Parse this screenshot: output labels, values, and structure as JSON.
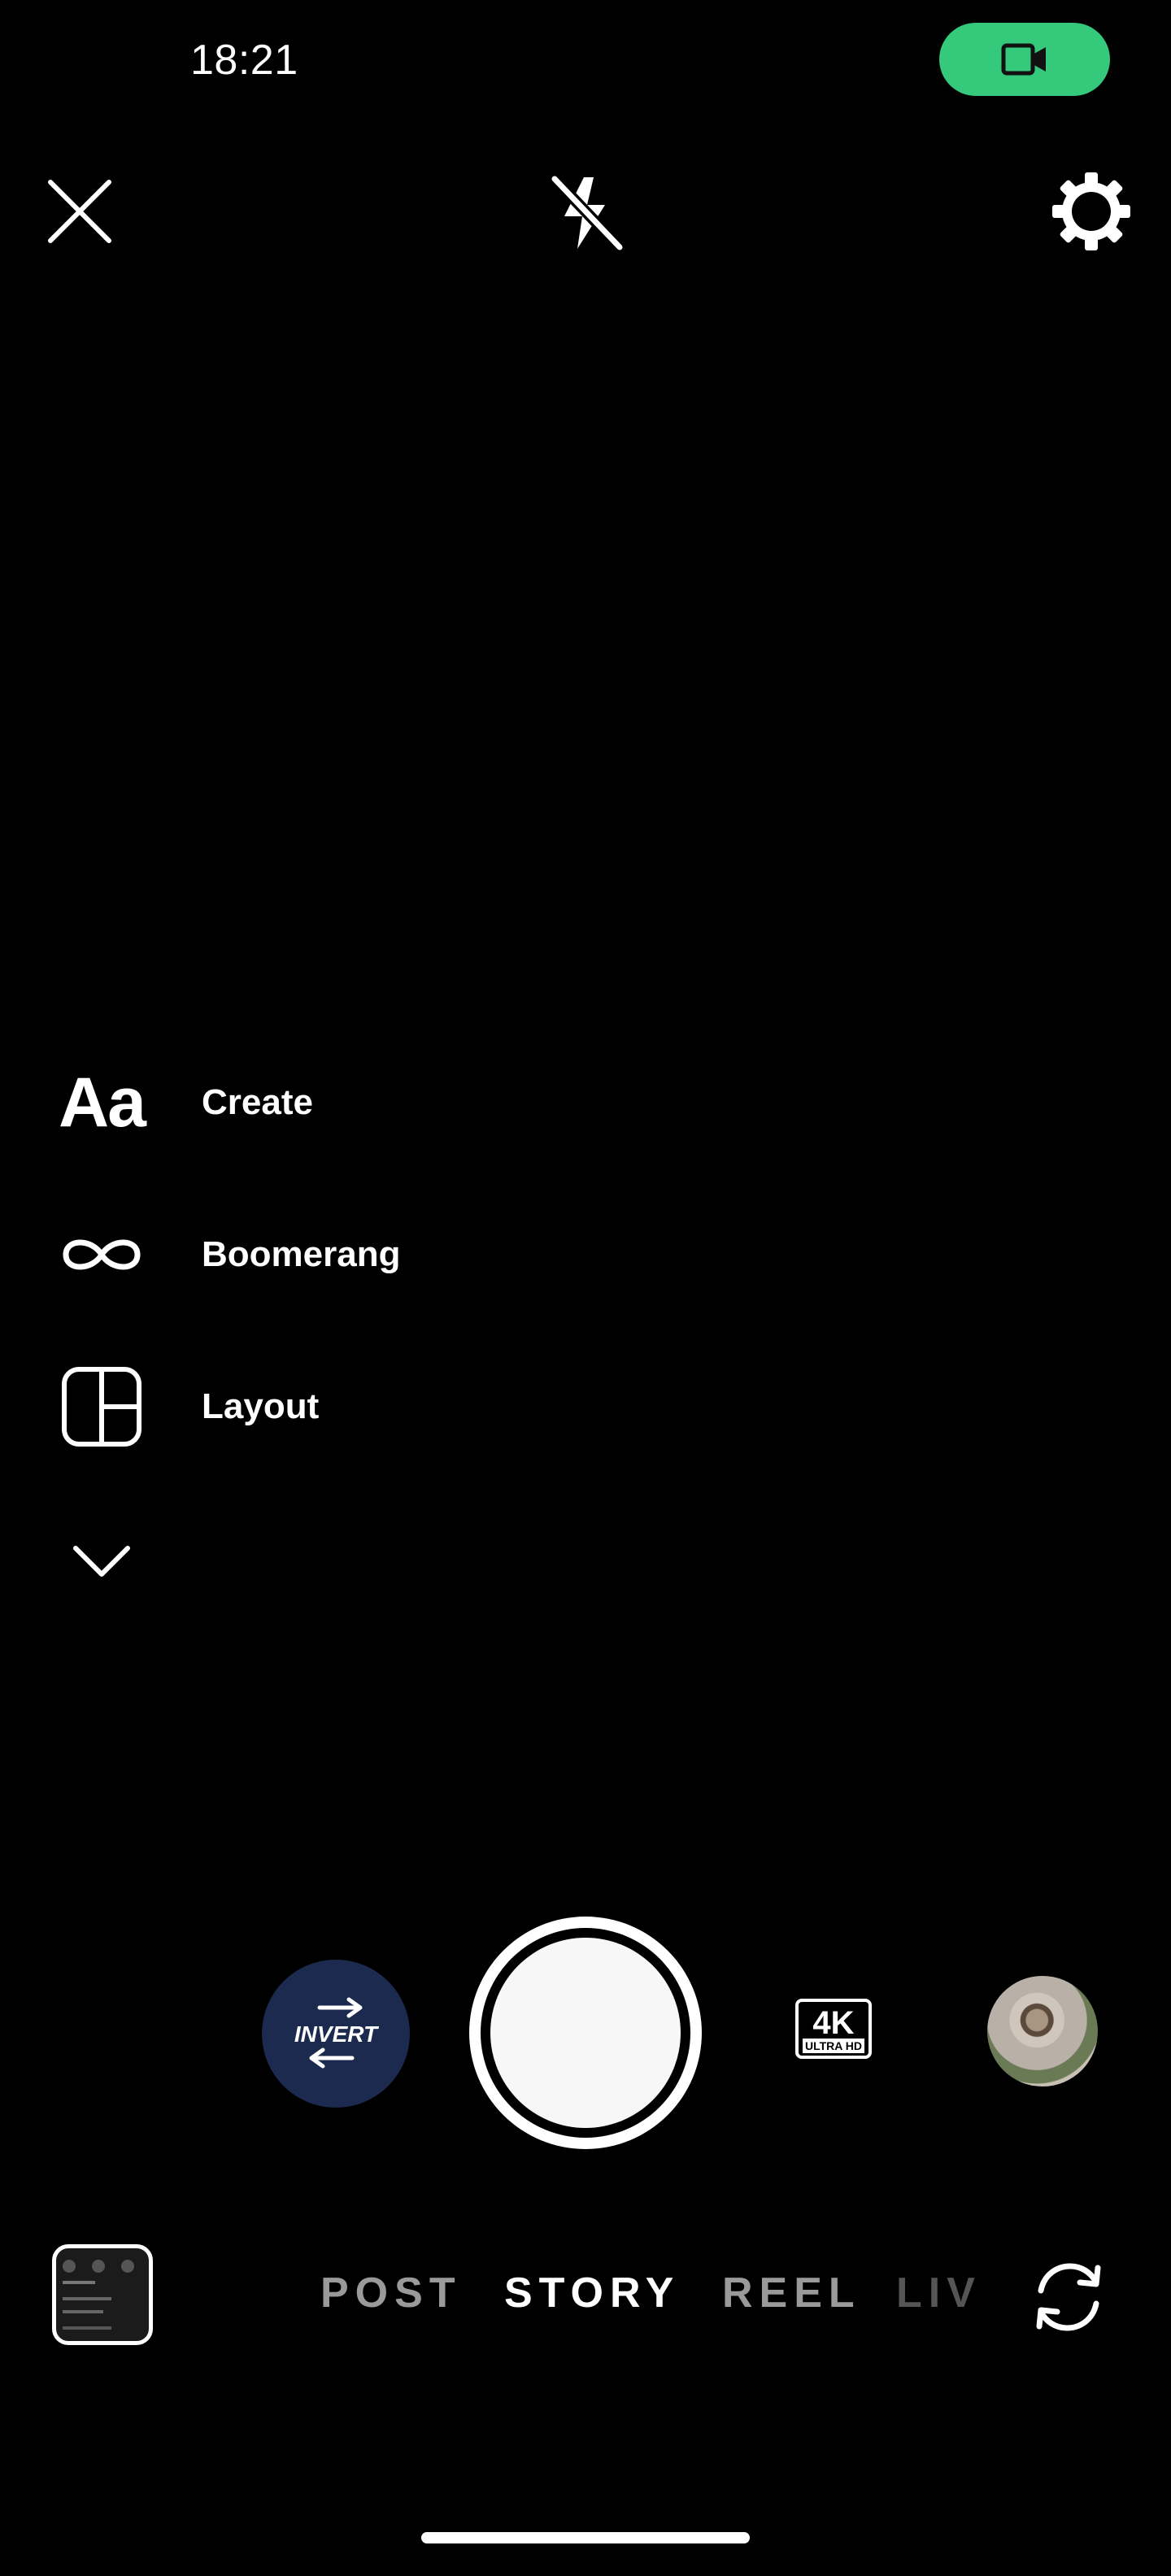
{
  "status": {
    "time": "18:21",
    "recording_indicator_color": "#35c97c",
    "recording_icon": "video-camera-icon"
  },
  "top_bar": {
    "close_icon": "close-icon",
    "flash_icon": "flash-off-icon",
    "settings_icon": "gear-icon"
  },
  "tools": [
    {
      "label": "Create",
      "icon_text": "Aa"
    },
    {
      "label": "Boomerang",
      "icon": "infinity-icon"
    },
    {
      "label": "Layout",
      "icon": "layout-grid-icon"
    }
  ],
  "tools_expand_icon": "chevron-down-icon",
  "effects": {
    "invert": {
      "text": "INVERT",
      "bg_color": "#1d2a4f"
    },
    "four_k": {
      "big": "4K",
      "small": "ULTRA HD"
    }
  },
  "modes": [
    "POST",
    "STORY",
    "REEL",
    "LIV"
  ],
  "active_mode": "STORY",
  "flip_camera_icon": "flip-camera-icon"
}
